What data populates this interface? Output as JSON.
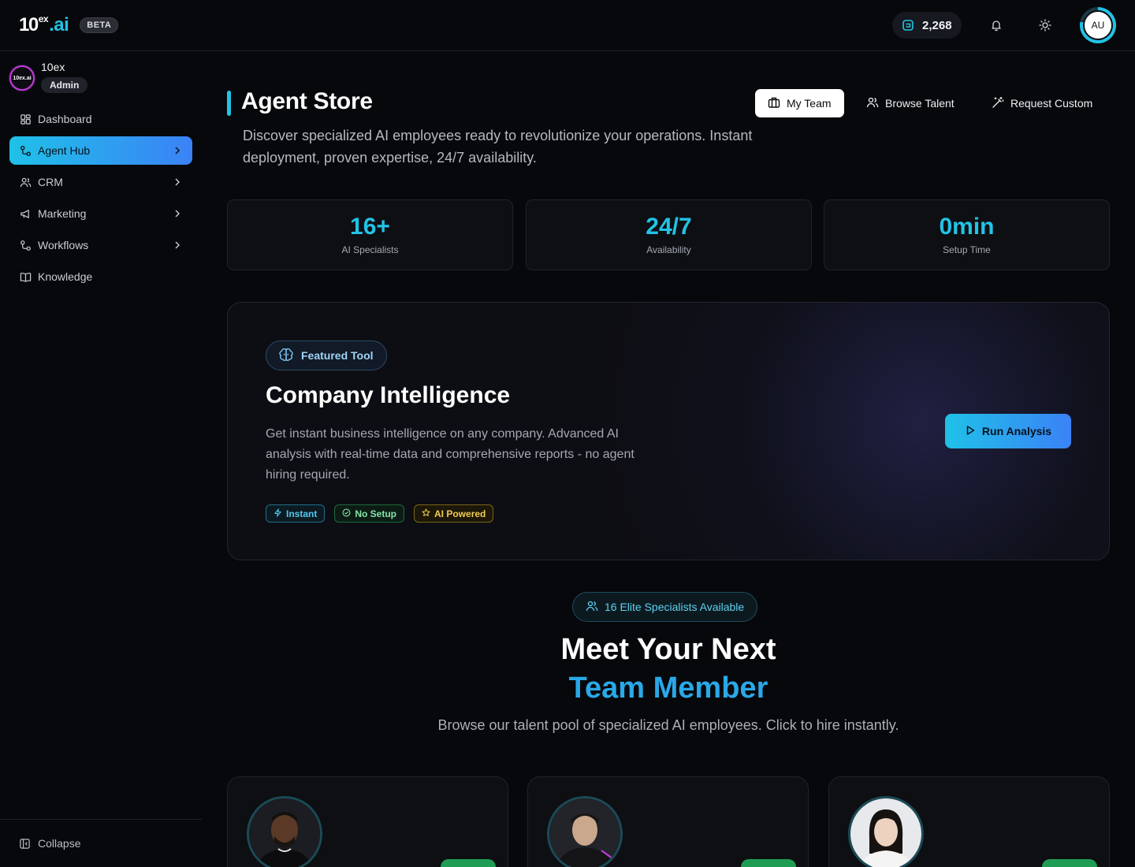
{
  "brand": {
    "logo_main": "10",
    "logo_sup": "ex",
    "logo_ai": ".ai",
    "beta": "BETA"
  },
  "topbar": {
    "credits": "2,268",
    "avatar_initials": "AU",
    "icons": [
      "coin-icon",
      "bell-icon",
      "sun-icon"
    ]
  },
  "org": {
    "name": "10ex",
    "role": "Admin",
    "logo_text": "10ex.ai"
  },
  "sidebar": {
    "items": [
      {
        "label": "Dashboard",
        "icon": "dashboard-icon",
        "chevron": false,
        "active": false
      },
      {
        "label": "Agent Hub",
        "icon": "agent-hub-icon",
        "chevron": true,
        "active": true
      },
      {
        "label": "CRM",
        "icon": "users-icon",
        "chevron": true,
        "active": false
      },
      {
        "label": "Marketing",
        "icon": "megaphone-icon",
        "chevron": true,
        "active": false
      },
      {
        "label": "Workflows",
        "icon": "workflow-icon",
        "chevron": true,
        "active": false
      },
      {
        "label": "Knowledge",
        "icon": "book-icon",
        "chevron": false,
        "active": false
      }
    ],
    "collapse": "Collapse"
  },
  "header": {
    "title": "Agent Store",
    "description": "Discover specialized AI employees ready to revolutionize your operations. Instant deployment, proven expertise, 24/7 availability.",
    "buttons": {
      "my_team": "My Team",
      "browse_talent": "Browse Talent",
      "request_custom": "Request Custom"
    }
  },
  "stats": [
    {
      "value": "16+",
      "label": "AI Specialists"
    },
    {
      "value": "24/7",
      "label": "Availability"
    },
    {
      "value": "0min",
      "label": "Setup Time"
    }
  ],
  "featured": {
    "pill": "Featured Tool",
    "title": "Company Intelligence",
    "description": "Get instant business intelligence on any company. Advanced AI analysis with real-time data and comprehensive reports - no agent hiring required.",
    "tags": [
      "Instant",
      "No Setup",
      "AI Powered"
    ],
    "cta": "Run Analysis"
  },
  "talent": {
    "pill": "16 Elite Specialists Available",
    "heading_line1": "Meet Your Next",
    "heading_line2": "Team Member",
    "subtitle": "Browse our talent pool of specialized AI employees. Click to hire instantly."
  },
  "colors": {
    "accent": "#22c3e6",
    "accent_blue": "#3b82f6",
    "background": "#07080b",
    "available_green": "#1f9d55"
  }
}
